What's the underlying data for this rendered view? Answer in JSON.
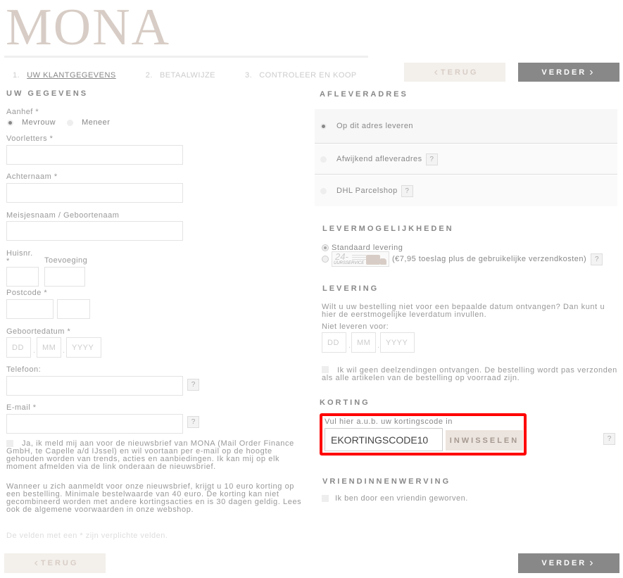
{
  "brand": {
    "logo": "MONA"
  },
  "steps": [
    {
      "num": "1.",
      "label": "UW KLANTGEGEVENS",
      "active": true
    },
    {
      "num": "2.",
      "label": "BETAALWIJZE",
      "active": false
    },
    {
      "num": "3.",
      "label": "CONTROLEER EN KOOP",
      "active": false
    }
  ],
  "nav": {
    "back_label": "TERUG",
    "next_label": "VERDER"
  },
  "left": {
    "title": "UW GEGEVENS",
    "aanhef_label": "Aanhef *",
    "aanhef_options": [
      {
        "label": "Mevrouw",
        "selected": true
      },
      {
        "label": "Meneer",
        "selected": false
      }
    ],
    "voorletters_label": "Voorletters *",
    "voorletters_value": "",
    "achternaam_label": "Achternaam *",
    "achternaam_value": "",
    "meisjesnaam_label": "Meisjesnaam / Geboortenaam",
    "meisjesnaam_value": "",
    "huisnr_label": "Huisnr.",
    "huisnr_required": "*",
    "toevoeging_label": "Toevoeging",
    "postcode_label": "Postcode *",
    "geboortedatum_label": "Geboortedatum *",
    "date_placeholders": {
      "dd": "DD",
      "mm": "MM",
      "yyyy": "YYYY"
    },
    "date_sep": ".",
    "telefoon_label": "Telefoon:",
    "email_label": "E-mail *",
    "help_glyph": "?",
    "newsletter_text": "Ja, ik meld mij aan voor de nieuwsbrief van MONA (Mail Order Finance GmbH, te Capelle a/d IJssel) en wil voortaan per e-mail op de hoogte gehouden worden van trends, acties en aanbiedingen. Ik kan mij op elk moment afmelden via de link onderaan de nieuwsbrief.",
    "newsletter_info": "Wanneer u zich aanmeldt voor onze nieuwsbrief, krijgt u 10 euro korting op een bestelling. Minimale bestelwaarde van 40 euro. De korting kan niet gecombineerd worden met andere kortingsacties en is 30 dagen geldig. Lees ook de algemene voorwaarden in onze webshop.",
    "required_note": "De velden met een * zijn verplichte velden."
  },
  "right": {
    "afleveradres_title": "AFLEVERADRES",
    "address_options": [
      {
        "label": "Op dit adres leveren",
        "selected": true,
        "help": false
      },
      {
        "label": "Afwijkend afleveradres",
        "selected": false,
        "help": true
      },
      {
        "label": "DHL Parcelshop",
        "selected": false,
        "help": true
      }
    ],
    "levermogelijkheden_title": "LEVERMOGELIJKHEDEN",
    "standaard_label": "Standaard levering",
    "express_badge_top": "24-",
    "express_badge_bottom": "UURSSERVICE",
    "express_label": "(€7,95 toeslag plus de gebruikelijke verzendkosten)",
    "levering_title": "LEVERING",
    "levering_text": "Wilt u uw bestelling niet voor een bepaalde datum ontvangen? Dan kunt u hier de eerstmogelijke leverdatum invullen.",
    "niet_leveren_label": "Niet leveren voor:",
    "deelzending_text": "Ik wil geen deelzendingen ontvangen. De bestelling wordt pas verzonden als alle artikelen van de bestelling op voorraad zijn.",
    "korting_title": "KORTING",
    "korting_label": "Vul hier a.u.b. uw kortingscode in",
    "korting_value": "EKORTINGSCODE10",
    "redeem_label": "INWISSELEN",
    "vriendin_title": "VRIENDINNENWERVING",
    "vriendin_label": "Ik ben door een vriendin geworven."
  },
  "colors": {
    "highlight": "#ff0000",
    "next_button": "#888888",
    "back_button": "#f3efeb",
    "logo": "#d8cdc6"
  }
}
